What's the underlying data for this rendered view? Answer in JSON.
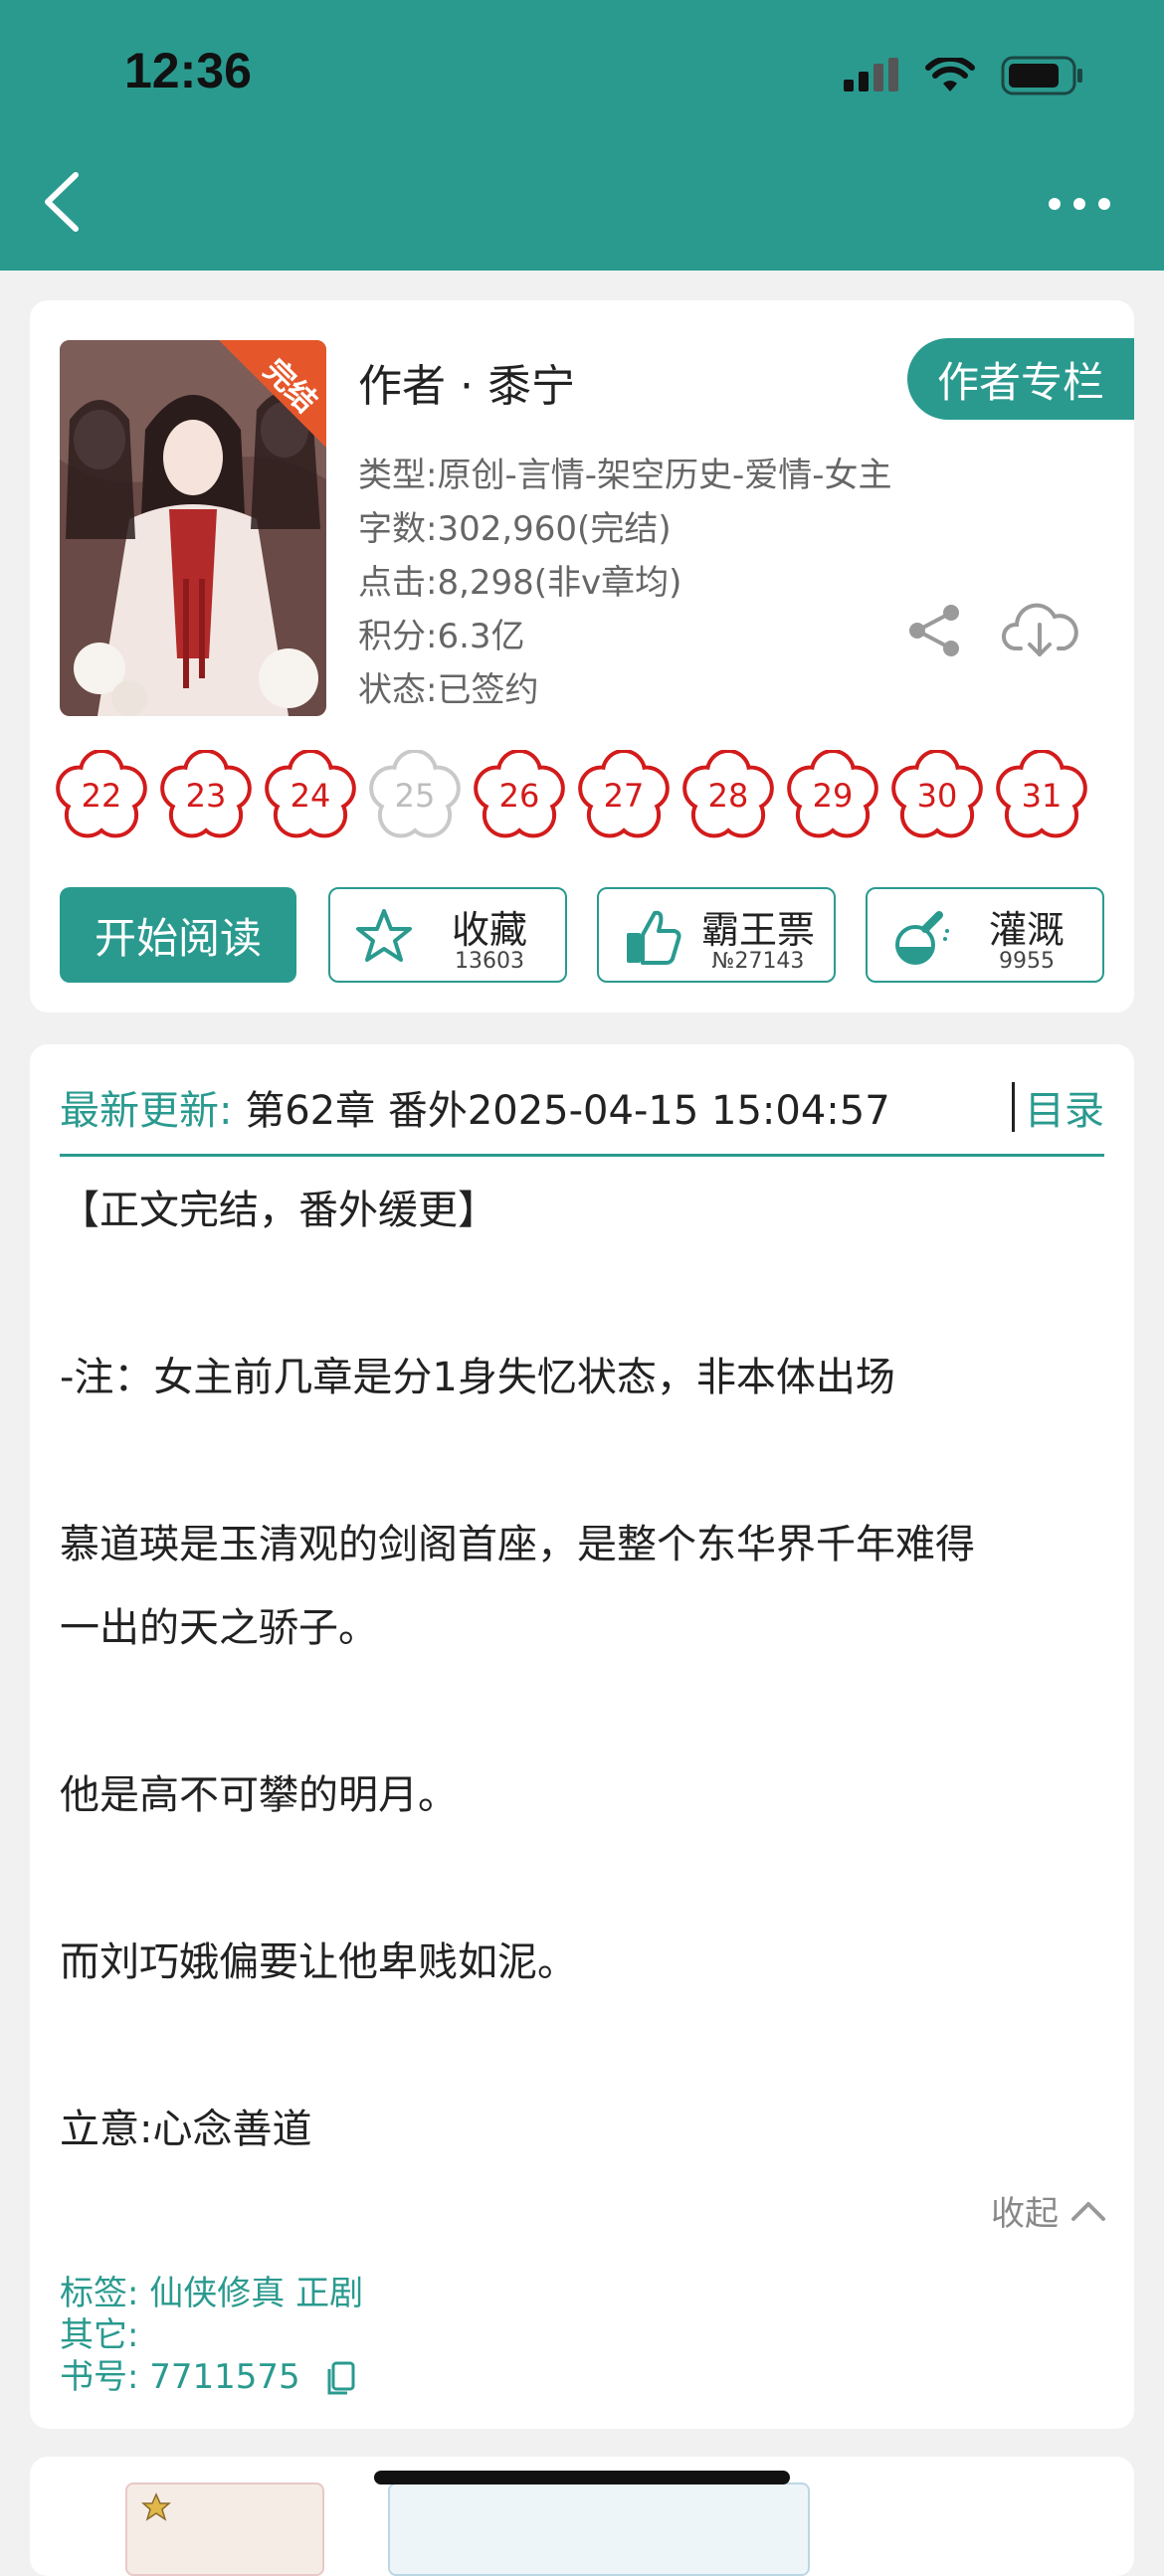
{
  "status_bar": {
    "time": "12:36"
  },
  "book": {
    "cover_badge": "完结",
    "author_line": "作者 · 黍宁",
    "author_column_button": "作者专栏",
    "meta": {
      "genre": "类型:原创-言情-架空历史-爱情-女主",
      "words": "字数:302,960(完结)",
      "clicks": "点击:8,298(非v章均)",
      "points": "积分:6.3亿",
      "status": "状态:已签约"
    },
    "flowers": [
      {
        "num": "22",
        "on": true
      },
      {
        "num": "23",
        "on": true
      },
      {
        "num": "24",
        "on": true
      },
      {
        "num": "25",
        "on": false
      },
      {
        "num": "26",
        "on": true
      },
      {
        "num": "27",
        "on": true
      },
      {
        "num": "28",
        "on": true
      },
      {
        "num": "29",
        "on": true
      },
      {
        "num": "30",
        "on": true
      },
      {
        "num": "31",
        "on": true
      }
    ],
    "start_read": "开始阅读",
    "actions": [
      {
        "label": "收藏",
        "count": "13603",
        "icon": "star-icon"
      },
      {
        "label": "霸王票",
        "count": "№27143",
        "icon": "thumbs-up-icon"
      },
      {
        "label": "灌溉",
        "count": "9955",
        "icon": "watering-bottle-icon"
      }
    ]
  },
  "update": {
    "label": "最新更新:",
    "text": "第62章 番外2025-04-15 15:04:57",
    "toc": "目录"
  },
  "description": [
    "【正文完结，番外缓更】",
    "-注：女主前几章是分1身失忆状态，非本体出场",
    "慕道瑛是玉清观的剑阁首座，是整个东华界千年难得",
    "一出的天之骄子。",
    "他是高不可攀的明月。",
    "而刘巧娥偏要让他卑贱如泥。",
    "立意:心念善道"
  ],
  "collapse": "收起",
  "tags": {
    "tags_line": "标签: 仙侠修真  正剧",
    "other_line": "其它:",
    "book_no_line": "书号: 7711575"
  },
  "colors": {
    "accent": "#2a9a8f",
    "flower": "#d31b1b"
  }
}
